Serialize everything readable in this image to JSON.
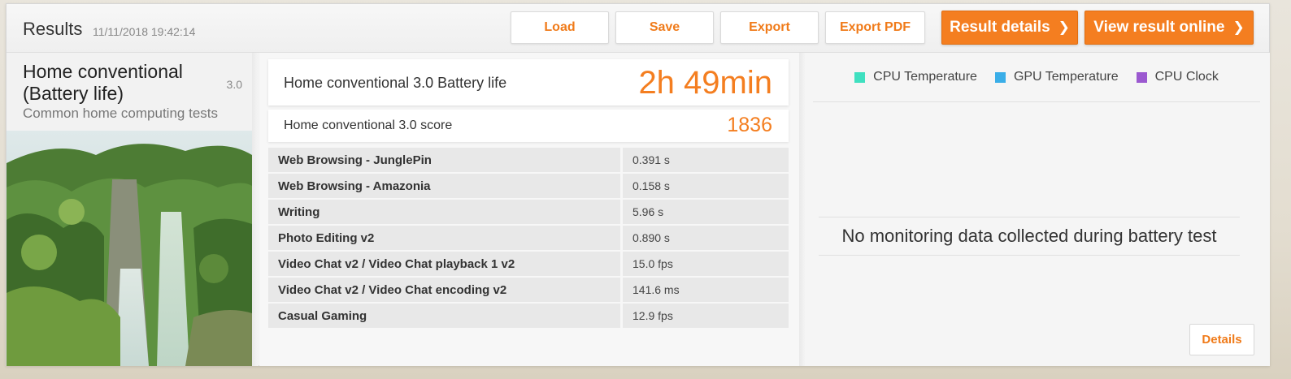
{
  "header": {
    "title": "Results",
    "timestamp": "11/11/2018 19:42:14",
    "buttons": {
      "load": "Load",
      "save": "Save",
      "export": "Export",
      "export_pdf": "Export PDF",
      "result_details": "Result details",
      "view_online": "View result online"
    },
    "chevron_glyph": "❯"
  },
  "benchmark": {
    "name": "Home conventional (Battery life)",
    "version": "3.0",
    "subtitle": "Common home computing tests",
    "image": "waterfall-forest-image"
  },
  "main_result": {
    "label": "Home conventional 3.0 Battery life",
    "value": "2h 49min"
  },
  "score": {
    "label": "Home conventional 3.0 score",
    "value": "1836"
  },
  "subtests": [
    {
      "name": "Web Browsing - JunglePin",
      "value": "0.391 s"
    },
    {
      "name": "Web Browsing - Amazonia",
      "value": "0.158 s"
    },
    {
      "name": "Writing",
      "value": "5.96 s"
    },
    {
      "name": "Photo Editing v2",
      "value": "0.890 s"
    },
    {
      "name": "Video Chat v2 / Video Chat playback 1 v2",
      "value": "15.0 fps"
    },
    {
      "name": "Video Chat v2 / Video Chat encoding v2",
      "value": "141.6 ms"
    },
    {
      "name": "Casual Gaming",
      "value": "12.9 fps"
    }
  ],
  "monitoring": {
    "legend": [
      {
        "label": "CPU Temperature",
        "color": "#3fe0c0"
      },
      {
        "label": "GPU Temperature",
        "color": "#3aaee8"
      },
      {
        "label": "CPU Clock",
        "color": "#9b59d0"
      }
    ],
    "message": "No monitoring data collected during battery test",
    "details_label": "Details"
  },
  "colors": {
    "accent": "#f47e20"
  }
}
